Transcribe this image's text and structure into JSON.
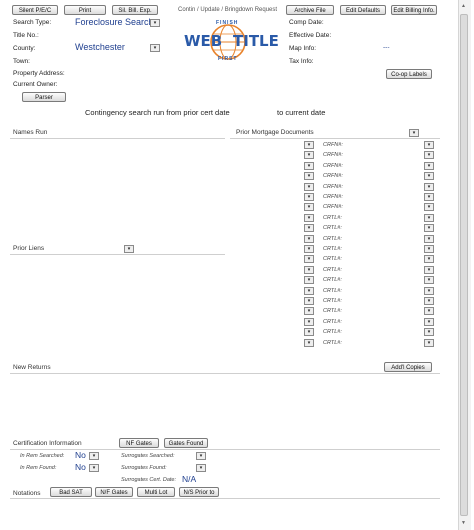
{
  "top_buttons": [
    "Silent P/E/C",
    "Print",
    "Sil. Bill. Exp."
  ],
  "header_caption": "Contin / Update / Bringdown Request",
  "right_buttons": [
    "Archive File",
    "Edit Defaults",
    "Edit Billing Info."
  ],
  "fields": {
    "search_type_label": "Search Type:",
    "search_type_value": "Foreclosure Search",
    "title_no_label": "Title No.:",
    "county_label": "County:",
    "county_value": "Westchester",
    "town_label": "Town:",
    "property_address_label": "Property Address:",
    "current_owner_label": "Current Owner:"
  },
  "right_fields": {
    "comp_date": "Comp Date:",
    "effective_date": "Effective Date:",
    "map_info": "Map Info:",
    "map_info_value": "---",
    "tax_info": "Tax Info:"
  },
  "logo": {
    "top": "FINISH",
    "main_left": "WEB",
    "main_right": "TITLE",
    "bottom": "FIRST"
  },
  "coop_labels_button": "Co-op Labels",
  "parser_button": "Parser",
  "contingency": {
    "left": "Contingency search run from prior cert date",
    "right": "to current date"
  },
  "sections": {
    "names_run": "Names Run",
    "prior_mortgage_docs": "Prior Mortgage Documents",
    "prior_liens": "Prior Liens",
    "new_returns": "New Returns",
    "certification_info": "Certification Information",
    "notations": "Notations"
  },
  "doc_rows": [
    "CRFN#:",
    "CRFN#:",
    "CRFN#:",
    "CRFN#:",
    "CRFN#:",
    "CRFN#:",
    "CRFN#:",
    "CRTL#:",
    "CRTL#:",
    "CRTL#:",
    "CRTL#:",
    "CRTL#:",
    "CRTL#:",
    "CRTL#:",
    "CRTL#:",
    "CRTL#:",
    "CRTL#:",
    "CRTL#:",
    "CRTL#:",
    "CRTL#:"
  ],
  "addl_copies_button": "Add'l Copies",
  "cert_buttons": [
    "NF Gates",
    "Gates Found"
  ],
  "cert_fields": {
    "in_rem_searched_label": "In Rem Searched:",
    "in_rem_searched_value": "No",
    "in_rem_found_label": "In Rem Found:",
    "in_rem_found_value": "No",
    "surrogates_searched_label": "Surrogates Searched:",
    "surrogates_found_label": "Surrogates Found:",
    "surrogates_cert_date_label": "Surrogates Cert. Date:",
    "surrogates_cert_date_value": "N/A"
  },
  "notation_buttons": [
    "Bad SAT",
    "N/F Gates",
    "Multi Lot",
    "N/S Prior to"
  ],
  "dropdown_glyph": "▾",
  "colors": {
    "value_blue": "#1f3f8f",
    "logo_blue": "#2a5aa8",
    "logo_orange": "#e8822a"
  }
}
